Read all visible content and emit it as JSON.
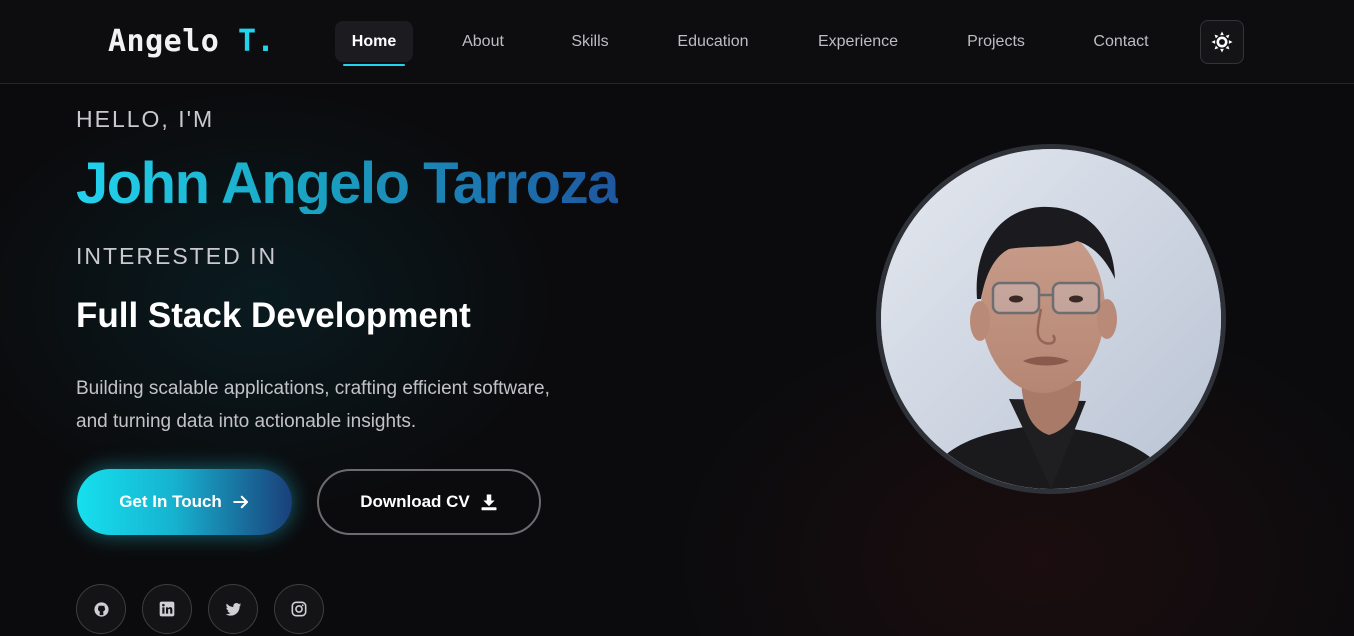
{
  "navbar": {
    "logo_name": "Angelo",
    "logo_accent": "T.",
    "items": [
      {
        "label": "Home",
        "active": true
      },
      {
        "label": "About",
        "active": false
      },
      {
        "label": "Skills",
        "active": false
      },
      {
        "label": "Education",
        "active": false
      },
      {
        "label": "Experience",
        "active": false
      },
      {
        "label": "Projects",
        "active": false
      },
      {
        "label": "Contact",
        "active": false
      }
    ],
    "theme_toggle_icon": "sun-icon"
  },
  "hero": {
    "greeting": "HELLO, I'M",
    "name": "John Angelo Tarroza",
    "interest_label": "INTERESTED IN",
    "role": "Full Stack Development",
    "description_lines": [
      "Building scalable applications, crafting efficient software,",
      "and turning data into actionable insights."
    ],
    "primary_button": {
      "label": "Get In Touch",
      "icon": "arrow-right-icon"
    },
    "secondary_button": {
      "label": "Download CV",
      "icon": "download-icon"
    },
    "socials": [
      {
        "icon": "github-icon"
      },
      {
        "icon": "linkedin-icon"
      },
      {
        "icon": "twitter-icon"
      },
      {
        "icon": "instagram-icon"
      }
    ]
  },
  "colors": {
    "accent": "#22d3ee",
    "gradient_end": "#1e56a0",
    "background": "#0b0b0d"
  }
}
